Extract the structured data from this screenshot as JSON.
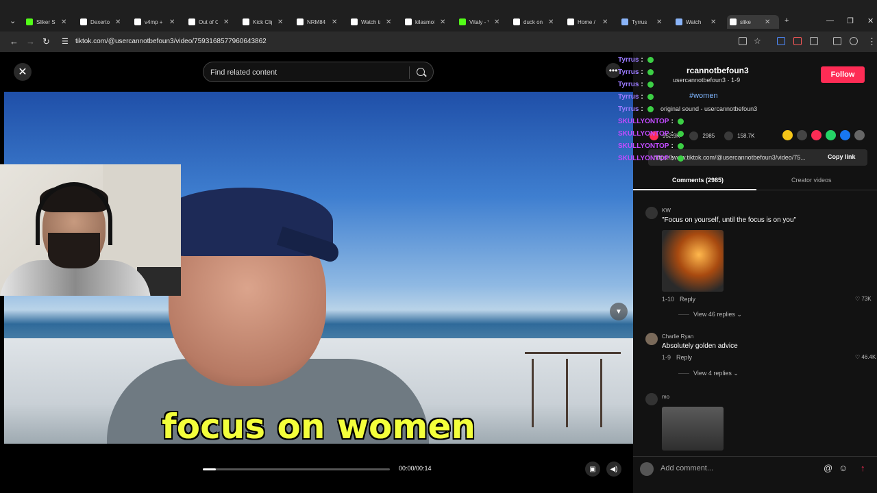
{
  "browser": {
    "tabs": [
      {
        "title": "Sliker St",
        "icon": "kick-icon",
        "color": "#53fc18"
      },
      {
        "title": "Dexerto",
        "icon": "x-icon",
        "color": "#ffffff"
      },
      {
        "title": "v4mp +",
        "icon": "x-icon",
        "color": "#ffffff"
      },
      {
        "title": "Out of C",
        "icon": "x-icon",
        "color": "#ffffff"
      },
      {
        "title": "Kick Clip",
        "icon": "x-icon",
        "color": "#ffffff"
      },
      {
        "title": "NRM84",
        "icon": "x-icon",
        "color": "#ffffff"
      },
      {
        "title": "Watch tr",
        "icon": "tiktok-icon",
        "color": "#ffffff"
      },
      {
        "title": "kilasmok",
        "icon": "tiktok-icon",
        "color": "#ffffff"
      },
      {
        "title": "Vitaly - V",
        "icon": "kick-icon",
        "color": "#53fc18"
      },
      {
        "title": "duck on",
        "icon": "x-icon",
        "color": "#ffffff"
      },
      {
        "title": "Home /",
        "icon": "x-icon",
        "color": "#ffffff"
      },
      {
        "title": "Tyrrus",
        "icon": "globe-icon",
        "color": "#8ab4f8"
      },
      {
        "title": "Watch",
        "icon": "globe-icon",
        "color": "#8ab4f8"
      },
      {
        "title": "slike",
        "icon": "tiktok-icon",
        "color": "#ffffff",
        "active": true
      }
    ],
    "url": "tiktok.com/@usercannotbefoun3/video/7593168577960643862"
  },
  "chat_overlay": [
    {
      "user": "Tyrrus",
      "sep": ":",
      "color": "#9b7bff"
    },
    {
      "user": "Tyrrus",
      "sep": ":",
      "color": "#9b7bff"
    },
    {
      "user": "Tyrrus",
      "sep": ":",
      "color": "#9b7bff"
    },
    {
      "user": "Tyrrus",
      "sep": ":",
      "color": "#9b7bff"
    },
    {
      "user": "Tyrrus",
      "sep": ":",
      "color": "#9b7bff"
    },
    {
      "user": "SKULLYONTOP",
      "sep": ":",
      "color": "#c24bff"
    },
    {
      "user": "SKULLYONTOP",
      "sep": ":",
      "color": "#c24bff"
    },
    {
      "user": "SKULLYONTOP",
      "sep": ":",
      "color": "#c24bff"
    },
    {
      "user": "SKULLYONTOP",
      "sep": ":",
      "color": "#c24bff"
    }
  ],
  "player": {
    "search_placeholder": "Find related content",
    "caption": "focus on women",
    "time": "00:00/00:14",
    "progress": 0.07
  },
  "sidebar": {
    "author": "rcannotbefoun3",
    "author_sub": "usercannotbefoun3 · 1-9",
    "hashtag": "#women",
    "sound": "original sound - usercannotbefoun3",
    "follow_label": "Follow",
    "likes": "952.9K",
    "comments": "2985",
    "saves": "158.7K",
    "link": "https://www.tiktok.com/@usercannotbefoun3/video/75...",
    "copy_link": "Copy link",
    "tab_comments": "Comments (2985)",
    "tab_creator": "Creator videos",
    "comment_list": [
      {
        "name": "KW",
        "text": "\"Focus on yourself, until the focus is on you\"",
        "date": "1-10",
        "reply": "Reply",
        "likes": "73K",
        "view_replies": "View 46 replies"
      },
      {
        "name": "Charlie Ryan",
        "text": "Absolutely golden advice",
        "date": "1-9",
        "reply": "Reply",
        "likes": "46.4K",
        "view_replies": "View 4 replies"
      },
      {
        "name": "mo",
        "text": "",
        "date": "",
        "reply": "",
        "likes": "",
        "view_replies": ""
      }
    ],
    "add_comment_placeholder": "Add comment..."
  }
}
